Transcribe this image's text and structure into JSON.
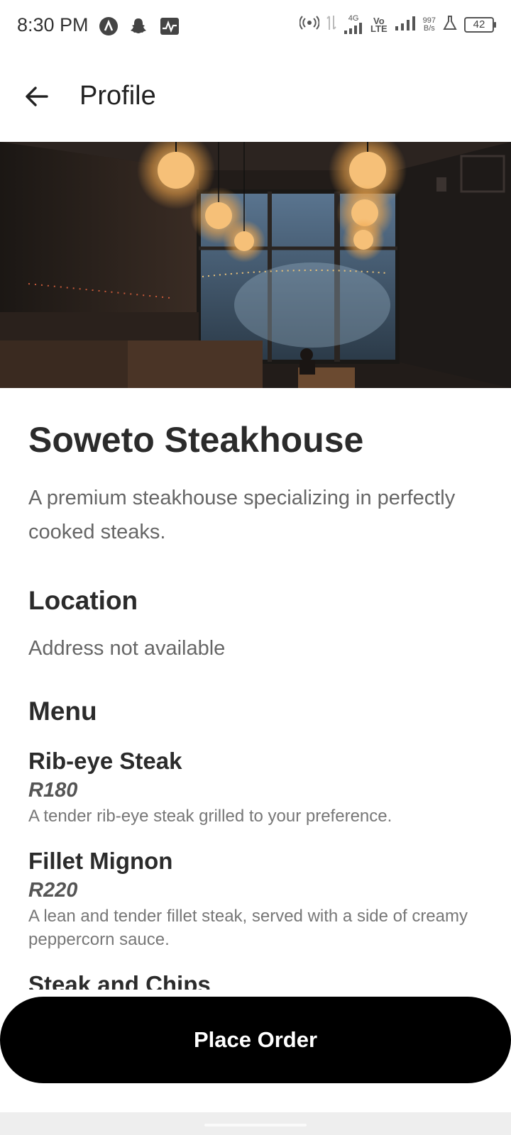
{
  "status_bar": {
    "time": "8:30 PM",
    "app_icons": [
      "a-circle-icon",
      "snapchat-icon",
      "activity-icon"
    ],
    "net_4g": "4G",
    "volte_top": "Vo",
    "volte_bottom": "LTE",
    "speed_value": "997",
    "speed_unit": "B/s",
    "battery": "42"
  },
  "app_bar": {
    "title": "Profile",
    "back_icon": "arrow-left-icon"
  },
  "hero": {
    "icon": "restaurant-photo"
  },
  "restaurant": {
    "name": "Soweto Steakhouse",
    "description": "A premium steakhouse specializing in perfectly cooked steaks."
  },
  "location": {
    "heading": "Location",
    "address": "Address not available"
  },
  "menu": {
    "heading": "Menu",
    "items": [
      {
        "name": "Rib-eye Steak",
        "price": "R180",
        "description": "A tender rib-eye steak grilled to your preference."
      },
      {
        "name": "Fillet Mignon",
        "price": "R220",
        "description": "A lean and tender fillet steak, served with a side of creamy peppercorn sauce."
      },
      {
        "name": "Steak and Chips",
        "price": "",
        "description": ""
      }
    ]
  },
  "actions": {
    "place_order": "Place Order"
  },
  "colors": {
    "button_bg": "#000000",
    "button_text": "#ffffff",
    "text_primary": "#2b2b2b",
    "text_secondary": "#666666"
  }
}
